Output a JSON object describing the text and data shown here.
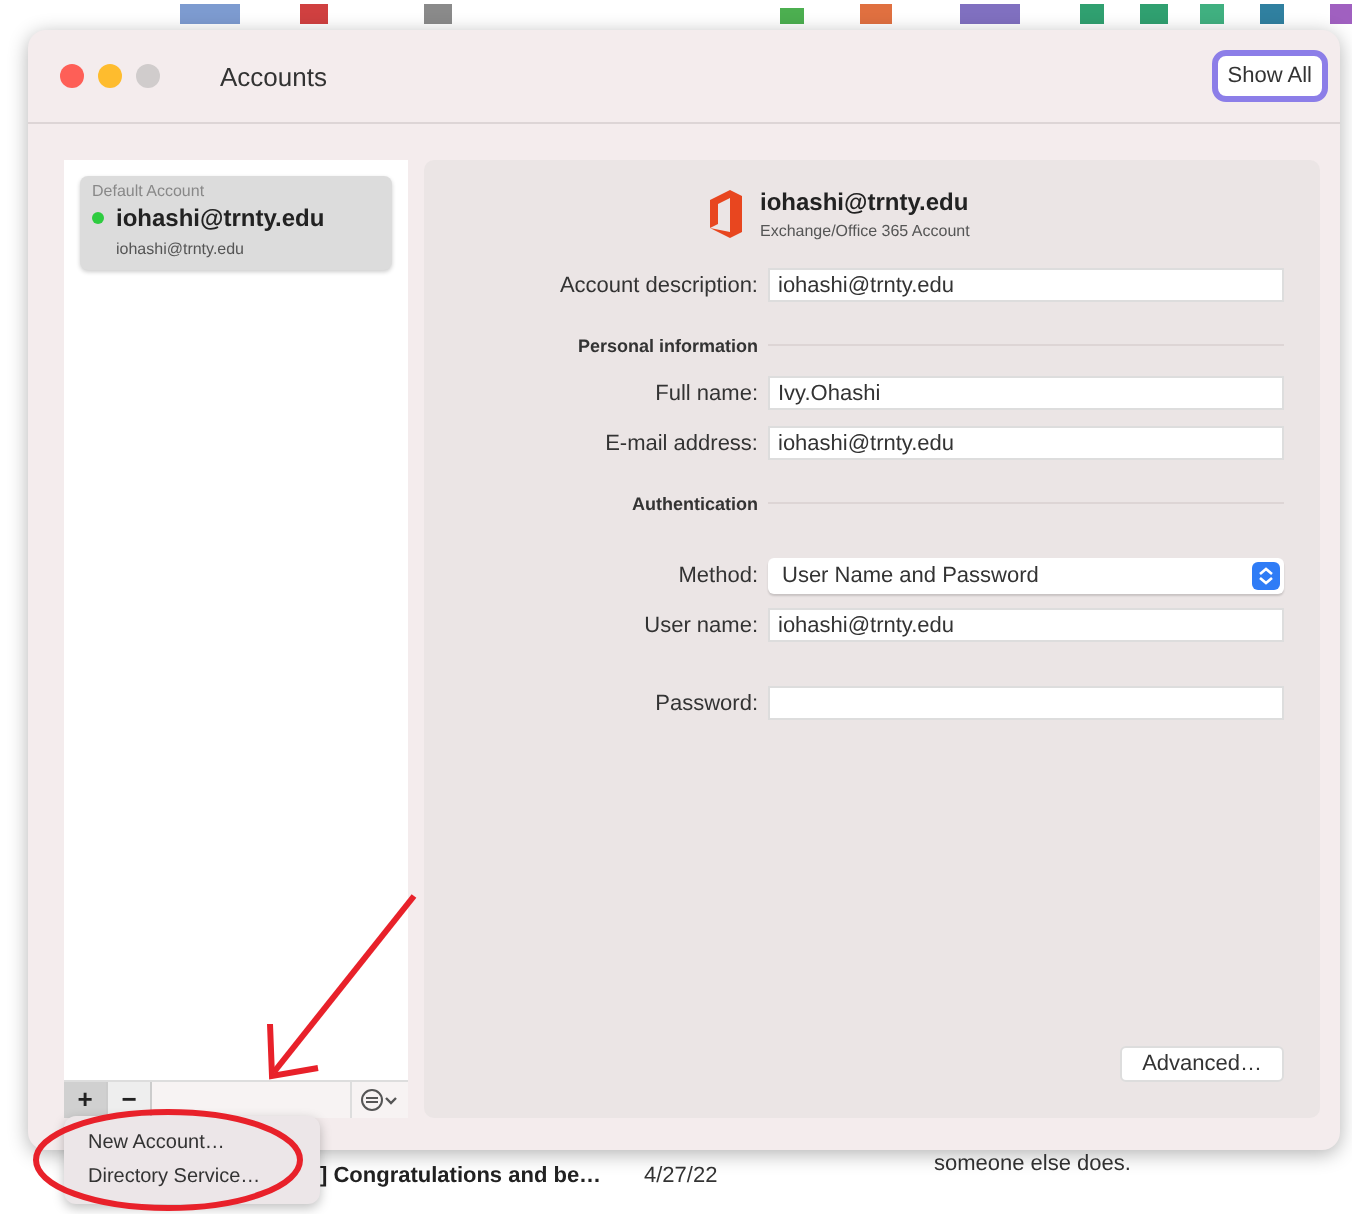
{
  "window": {
    "title": "Accounts",
    "show_all_button": "Show All"
  },
  "accounts": [
    {
      "group": "Default Account",
      "name": "iohashi@trnty.edu",
      "detail": "iohashi@trnty.edu",
      "selected": true,
      "online": true
    }
  ],
  "list_buttons": [
    "+",
    "−"
  ],
  "account_header": {
    "name": "iohashi@trnty.edu",
    "type": "Exchange/Office 365 Account"
  },
  "fields": [
    {
      "kind": "text",
      "label": "Account description:",
      "value": "iohashi@trnty.edu"
    },
    {
      "kind": "section",
      "label": "Personal information"
    },
    {
      "kind": "text",
      "label": "Full name:",
      "value": "Ivy.Ohashi"
    },
    {
      "kind": "text",
      "label": "E-mail address:",
      "value": "iohashi@trnty.edu"
    },
    {
      "kind": "section",
      "label": "Authentication"
    },
    {
      "kind": "select",
      "label": "Method:",
      "value": "User Name and Password"
    },
    {
      "kind": "text",
      "label": "User name:",
      "value": "iohashi@trnty.edu"
    },
    {
      "kind": "password",
      "label": "Password:"
    }
  ],
  "advanced_button": "Advanced…",
  "add_menu": [
    {
      "label": "New Account…"
    },
    {
      "label": "Directory Service…"
    }
  ],
  "background": {
    "message_subject": "] Congratulations and be…",
    "message_date": "4/27/22",
    "preview_text": "someone else does."
  }
}
